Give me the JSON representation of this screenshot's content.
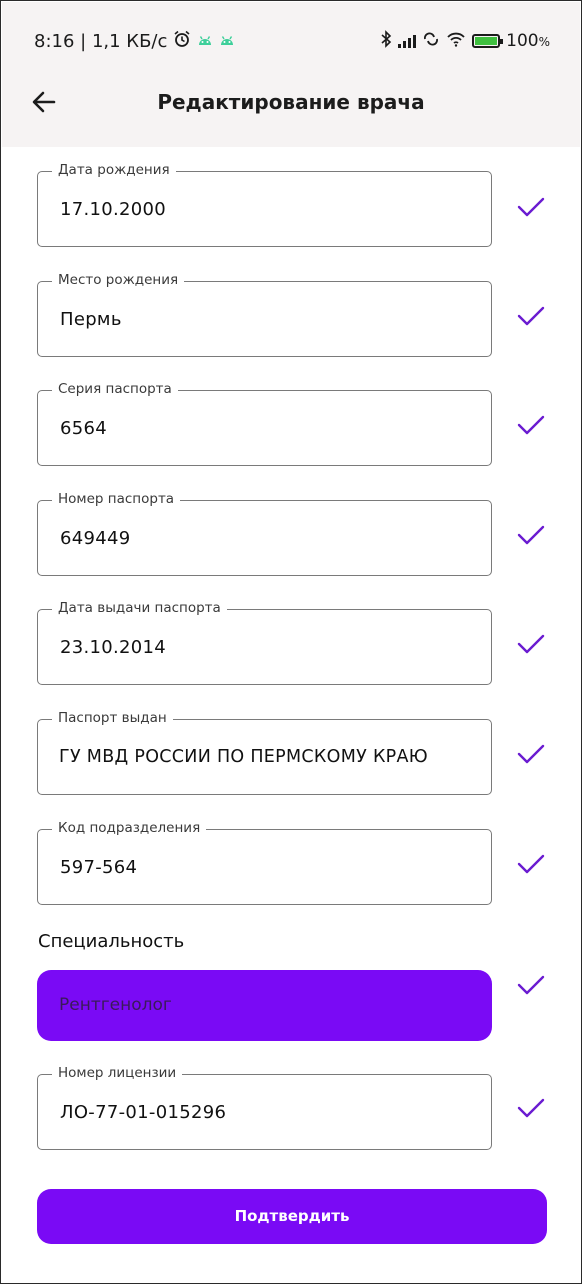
{
  "status_bar": {
    "time": "8:16",
    "speed": "1,1 КБ/с",
    "battery": "100",
    "battery_unit": "%",
    "icons": [
      "alarm-icon",
      "android-icon",
      "android-icon",
      "bluetooth-icon",
      "signal-icon",
      "sync-icon",
      "wifi-icon",
      "battery-icon"
    ]
  },
  "header": {
    "title": "Редактирование врача",
    "back_icon": "arrow-left-icon"
  },
  "fields": [
    {
      "label": "Дата рождения",
      "value": "17.10.2000"
    },
    {
      "label": "Место рождения",
      "value": "Пермь"
    },
    {
      "label": "Серия паспорта",
      "value": "6564"
    },
    {
      "label": "Номер паспорта",
      "value": "649449"
    },
    {
      "label": "Дата выдачи паспорта",
      "value": "23.10.2014"
    },
    {
      "label": "Паспорт выдан",
      "value": "ГУ МВД РОССИИ ПО ПЕРМСКОМУ КРАЮ"
    },
    {
      "label": "Код подразделения",
      "value": "597-564"
    }
  ],
  "specialty": {
    "label": "Специальность",
    "value": "Рентгенолог"
  },
  "license": {
    "label": "Номер лицензии",
    "value": "ЛО-77-01-015296"
  },
  "submit_label": "Подтвердить",
  "colors": {
    "accent": "#7a0af5",
    "check": "#6a1bd1",
    "header_bg": "#f6f3f3"
  }
}
